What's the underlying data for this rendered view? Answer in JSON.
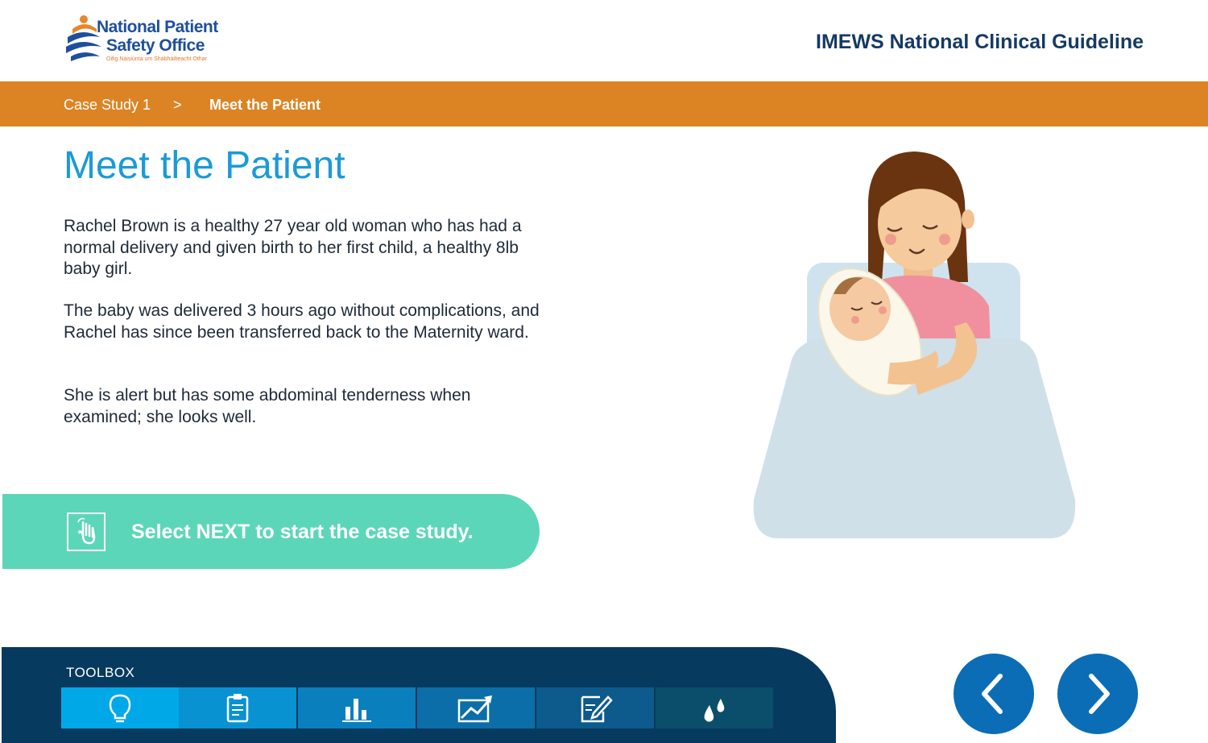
{
  "header": {
    "logo": {
      "line1": "National Patient",
      "line2": "Safety Office",
      "line3": "Oifig Náisiúnta um Shábháilteacht Othar"
    },
    "title": "IMEWS National Clinical Guideline"
  },
  "breadcrumb": {
    "items": [
      "Case Study 1",
      "Meet the Patient"
    ],
    "separator": ">"
  },
  "main": {
    "title": "Meet the Patient",
    "paragraphs": [
      "Rachel Brown is a healthy 27 year old woman who has had a normal delivery and given birth to her first child, a healthy 8lb baby girl.",
      "The baby was delivered 3 hours ago without complications, and Rachel has since been transferred back to the Maternity ward.",
      "She is alert but has some abdominal tenderness when examined; she looks well."
    ],
    "cta": {
      "label": "Select NEXT to start the case study.",
      "icon": "hand-pointer-icon"
    },
    "illustration": "mother-holding-baby-in-bed"
  },
  "toolbox": {
    "label": "TOOLBOX",
    "tools": [
      {
        "icon": "lightbulb-icon",
        "color": "#00a8e8"
      },
      {
        "icon": "clipboard-icon",
        "color": "#0892d2"
      },
      {
        "icon": "bar-chart-icon",
        "color": "#0a7fbd"
      },
      {
        "icon": "trend-chart-icon",
        "color": "#0b6ea8"
      },
      {
        "icon": "edit-notes-icon",
        "color": "#0d5a8c"
      },
      {
        "icon": "drops-icon",
        "color": "#0b4e6b"
      }
    ]
  },
  "navigation": {
    "prev_icon": "chevron-left-icon",
    "next_icon": "chevron-right-icon"
  },
  "colors": {
    "accent_orange": "#dc8424",
    "title_blue": "#1b9ad8",
    "cta_teal": "#5cd6b9",
    "toolbox_navy": "#073a5f",
    "nav_blue": "#0a6db5"
  }
}
